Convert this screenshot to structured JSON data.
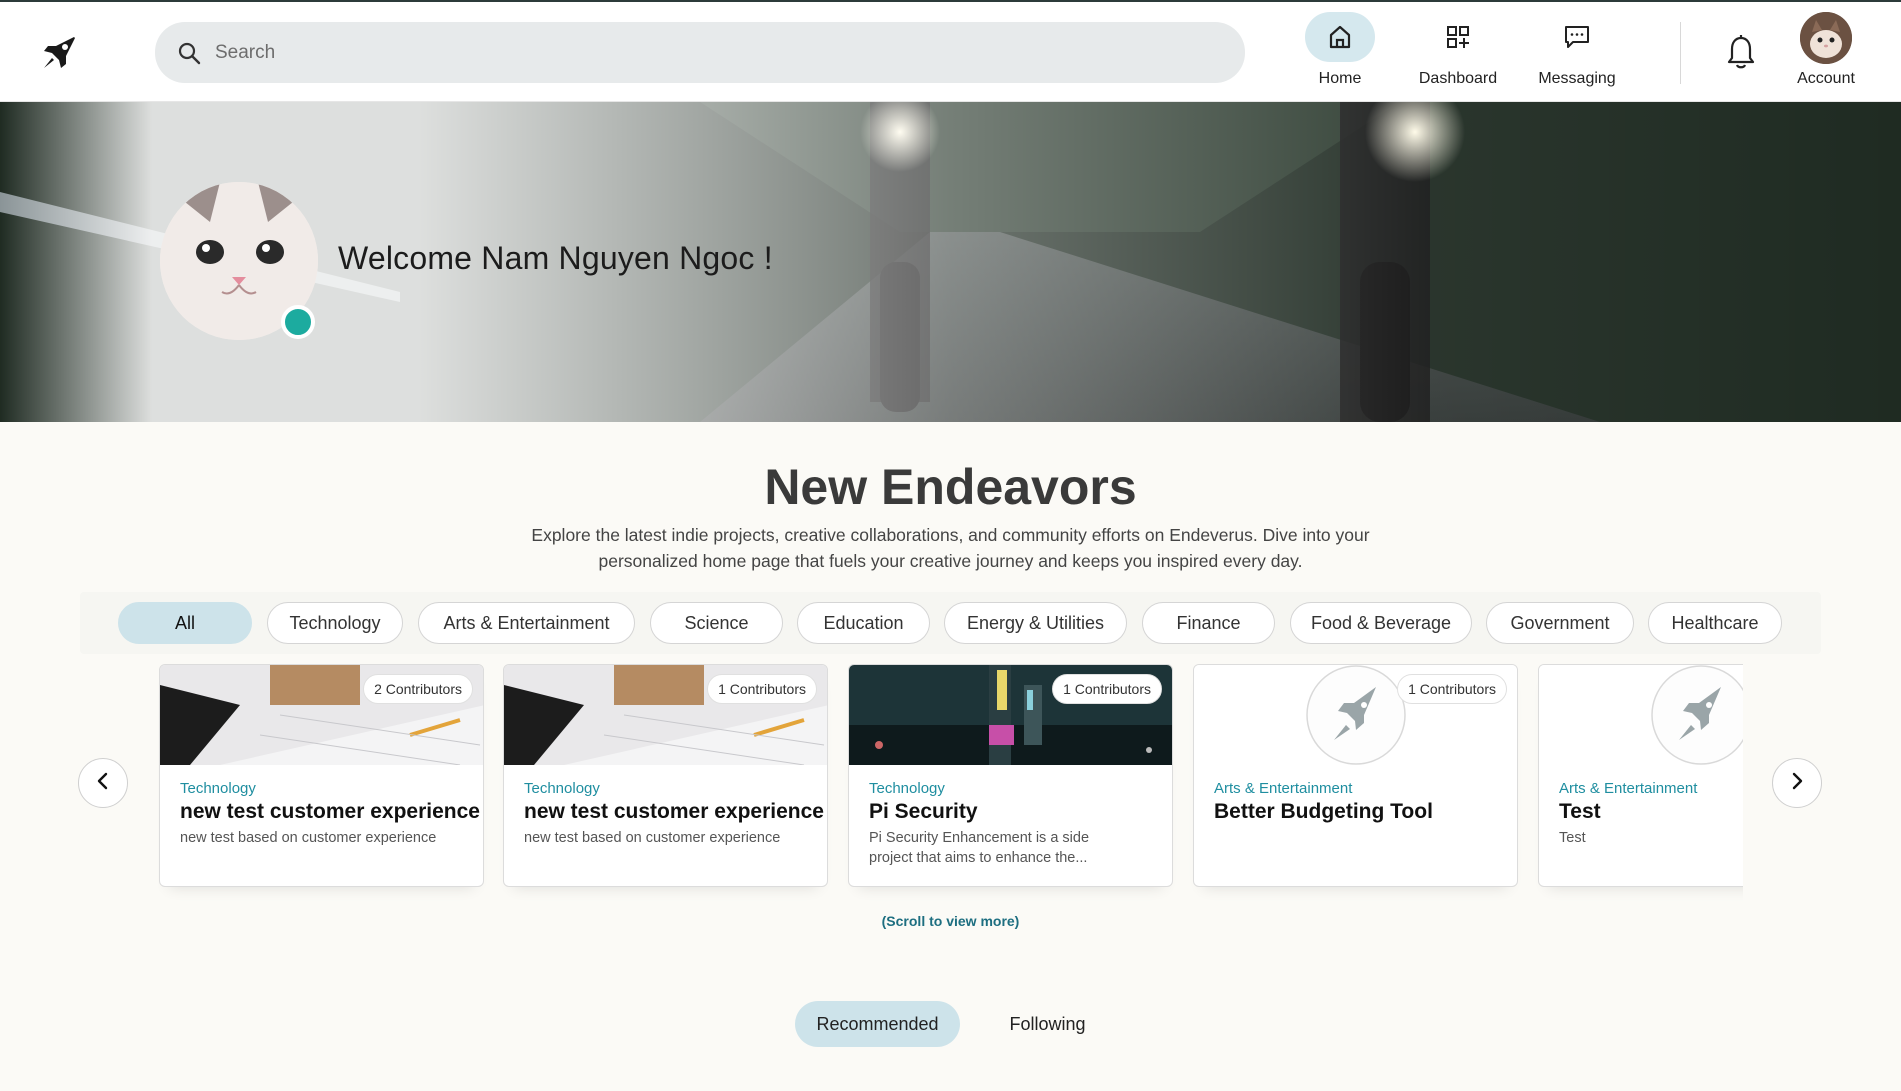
{
  "header": {
    "search_placeholder": "Search",
    "nav": [
      {
        "label": "Home",
        "icon": "home-icon",
        "active": true
      },
      {
        "label": "Dashboard",
        "icon": "dashboard-icon",
        "active": false
      },
      {
        "label": "Messaging",
        "icon": "message-icon",
        "active": false
      }
    ],
    "account_label": "Account"
  },
  "hero": {
    "welcome": "Welcome Nam Nguyen Ngoc !"
  },
  "endeavors": {
    "title": "New Endeavors",
    "description": "Explore the latest indie projects, creative collaborations, and community efforts on Endeverus. Dive into your personalized home page that fuels your creative journey and keeps you inspired every day.",
    "filters": [
      "All",
      "Technology",
      "Arts & Entertainment",
      "Science",
      "Education",
      "Energy & Utilities",
      "Finance",
      "Food & Beverage",
      "Government",
      "Healthcare"
    ],
    "active_filter": "All",
    "cards": [
      {
        "badge": "2 Contributors",
        "category": "Technology",
        "title": "new test customer experience",
        "description": "new test based on customer experience",
        "image": "desk-photo"
      },
      {
        "badge": "1 Contributors",
        "category": "Technology",
        "title": "new test customer experience",
        "description": "new test based on customer experience",
        "image": "desk-photo"
      },
      {
        "badge": "1 Contributors",
        "category": "Technology",
        "title": "Pi Security",
        "description": "Pi Security Enhancement is a side project that aims to enhance the...",
        "image": "city-night-photo"
      },
      {
        "badge": "1 Contributors",
        "category": "Arts & Entertainment",
        "title": "Better Budgeting Tool",
        "description": "",
        "image": "rocket-placeholder"
      },
      {
        "badge": "",
        "category": "Arts & Entertainment",
        "title": "Test",
        "description": "Test",
        "image": "rocket-placeholder"
      }
    ],
    "scroll_hint": "(Scroll to view more)"
  },
  "feed_tabs": [
    {
      "label": "Recommended",
      "active": true
    },
    {
      "label": "Following",
      "active": false
    }
  ],
  "colors": {
    "accent": "#1cab9f",
    "chip_active": "#cde3ea",
    "category_text": "#1f8ea0",
    "page_bg": "#fbfaf6"
  }
}
